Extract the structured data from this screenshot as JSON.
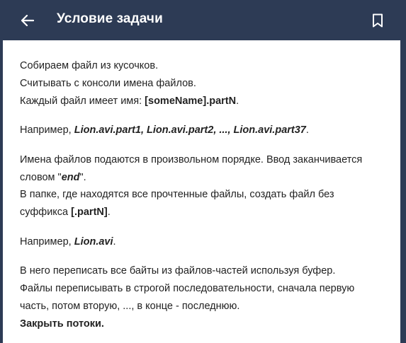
{
  "header": {
    "title": "Условие задачи",
    "back_icon": "arrow-left-icon",
    "bookmark_icon": "bookmark-icon"
  },
  "colors": {
    "header_bg": "#2d3b55",
    "content_bg": "#ffffff",
    "text": "#222222"
  },
  "task": {
    "p1": {
      "l1": "Собираем файл из кусочков.",
      "l2": "Считывать с консоли имена файлов.",
      "l3_prefix": "Каждый файл имеет имя: ",
      "l3_code": "[someName].partN",
      "l3_suffix": "."
    },
    "p2": {
      "prefix": "Например, ",
      "example": "Lion.avi.part1, Lion.avi.part2, ..., Lion.avi.part37",
      "suffix": "."
    },
    "p3": {
      "l1": "Имена файлов подаются в произвольном порядке. Ввод заканчивается",
      "l2_prefix": "словом \"",
      "l2_word": "end",
      "l2_suffix": "\".",
      "l3": "В папке, где находятся все прочтенные файлы, создать файл без",
      "l4_prefix": "суффикса ",
      "l4_code": "[.partN]",
      "l4_suffix": "."
    },
    "p4": {
      "prefix": "Например, ",
      "example": "Lion.avi",
      "suffix": "."
    },
    "p5": {
      "l1": "В него переписать все байты из файлов-частей используя буфер.",
      "l2": "Файлы переписывать в строгой последовательности, сначала первую",
      "l3": "часть, потом вторую, ..., в конце - последнюю.",
      "l4": "Закрыть потоки."
    }
  }
}
